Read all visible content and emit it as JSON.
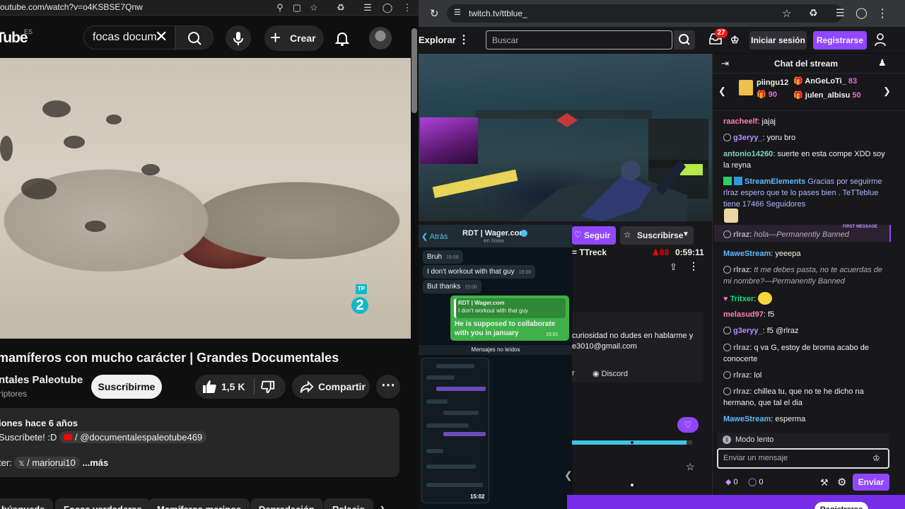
{
  "youtube": {
    "url": "outube.com/watch?v=o4KSBSE7Qnw",
    "logo": "Tube",
    "region": "ES",
    "search_value": "focas docum",
    "create_label": "Crear",
    "video_title": "mamíferos con mucho carácter | Grandes Documentales",
    "channel_name": "ntales Paleotube",
    "subscribers": "riptores",
    "subscribe_label": "Suscribirme",
    "likes": "1,5 K",
    "share_label": "Compartir",
    "views_line": "iones  hace 6 años",
    "desc_line1_prefix": "Suscríbete! :D",
    "desc_channel_link": "/ @documentalespaleotube469",
    "desc_line2_prefix": "ter:",
    "desc_line2_link": "/ mariorui10",
    "desc_more": "...más",
    "chips": [
      "búsqueda",
      "Focas verdaderas",
      "Mamíferos marinos",
      "Depredación",
      "Relacio"
    ],
    "video_badge": "TP",
    "video_badge_num": "2"
  },
  "twitch": {
    "url": "twitch.tv/ttblue_",
    "explore": "Explorar",
    "search_placeholder": "Buscar",
    "notification_count": "27",
    "login_label": "Iniciar sesión",
    "signup_label": "Registrarse",
    "follow_label": "Seguir",
    "subscribe_label": "Suscribirse",
    "streamer_name": "= TTreck",
    "viewers": "88",
    "uptime": "0:59:11",
    "panel_text": "curiosidad no dudes en hablarme y e3010@gmail.com",
    "panel_link": "r",
    "discord_label": "Discord",
    "footer_button": "Registrarse",
    "progress_fraction": 0.95
  },
  "whatsapp": {
    "back_label": "Atrás",
    "contact_name": "RDT | Wager.com",
    "status": "en línea",
    "messages_in": [
      {
        "text": "Bruh",
        "time": "15:00"
      },
      {
        "text": "I don't workout with that guy",
        "time": "15:00"
      },
      {
        "text": "But thanks",
        "time": "15:00"
      }
    ],
    "reply": {
      "quote_name": "RDT | Wager.com",
      "quote_text": "I don't workout with that guy",
      "text": "He is supposed to collaborate with you in january",
      "time": "15:01"
    },
    "unread_label": "Mensajes no leídos",
    "phone_time": "15:02"
  },
  "chat": {
    "title": "Chat del stream",
    "gifters": [
      {
        "name": "piingu12",
        "count": "90"
      },
      {
        "name": "AnGeLoTi_",
        "count": "83"
      },
      {
        "name": "julen_albisu",
        "count": "50"
      }
    ],
    "messages": [
      {
        "user": "raacheelf",
        "color": "#ff7fab",
        "text": "jajaj"
      },
      {
        "user": "g3eryy_",
        "color": "#b68cff",
        "text": "yoru bro"
      },
      {
        "user": "antonio14260",
        "color": "#7ad3c8",
        "text": "suerte en esta compe XDD soy la reyna"
      },
      {
        "user": "StreamElements",
        "color": "#5fb8ff",
        "text": "Gracias por seguirme rlraz espero que te lo pases bien . TeTTeblue tiene 17466 Seguidores",
        "text_color": "#a9b9ff"
      },
      {
        "user": "rlraz",
        "color": "#adadb8",
        "text": "hola",
        "banned": "—Permanently Banned"
      },
      {
        "user": "MaweStream",
        "color": "#5fb8ff",
        "text": "yeeepa"
      },
      {
        "user": "rlraz",
        "color": "#adadb8",
        "text": "tt me debes pasta, no te acuerdas de mi nombre?",
        "banned": "—Permanently Banned"
      },
      {
        "user": "Tritxer",
        "color": "#00e676",
        "text": ""
      },
      {
        "user": "melasud97",
        "color": "#ff7fab",
        "text": "f5"
      },
      {
        "user": "g3eryy_",
        "color": "#b68cff",
        "text": "f5 @rlraz"
      },
      {
        "user": "rlraz",
        "color": "#adadb8",
        "text": "q va G, estoy de broma acabo de conocerte"
      },
      {
        "user": "rlraz",
        "color": "#adadb8",
        "text": "lol"
      },
      {
        "user": "rlraz",
        "color": "#adadb8",
        "text": "chillea tu, que no te he dicho na hermano, que tal el dia"
      },
      {
        "user": "MaweStream",
        "color": "#5fb8ff",
        "text": "esperma"
      }
    ],
    "first_message_label": "FIRST MESSAGE",
    "slow_mode": "Modo lento",
    "input_placeholder": "Enviar un mensaje",
    "bits": "0",
    "points": "0",
    "send_label": "Enviar"
  }
}
